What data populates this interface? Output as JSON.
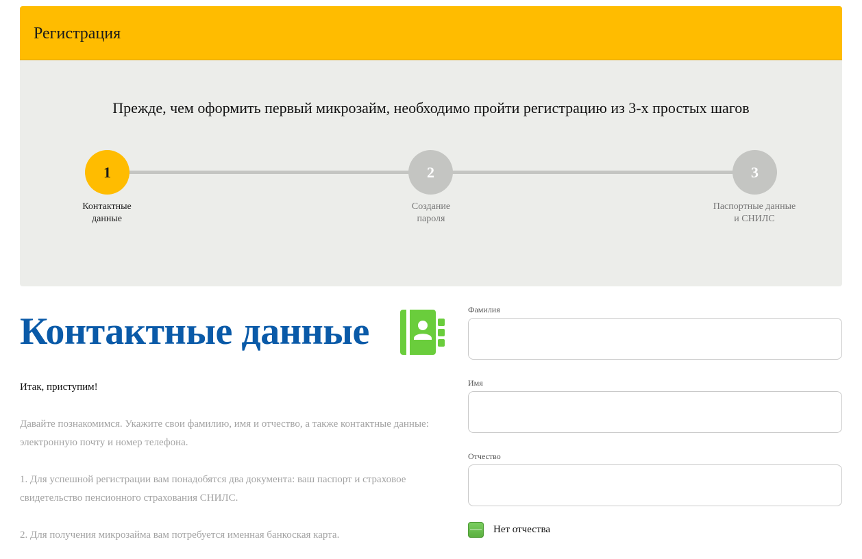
{
  "header": {
    "title": "Регистрация",
    "accent_color": "#ffbc00"
  },
  "intro_text": "Прежде, чем оформить первый микрозайм, необходимо пройти регистрацию из 3-х простых шагов",
  "steps": [
    {
      "number": "1",
      "line1": "Контактные",
      "line2": "данные",
      "active": true
    },
    {
      "number": "2",
      "line1": "Создание",
      "line2": "пароля",
      "active": false
    },
    {
      "number": "3",
      "line1": "Паспортные данные",
      "line2": "и СНИЛС",
      "active": false
    }
  ],
  "section": {
    "title": "Контактные данные",
    "title_color": "#0a5aa8",
    "icon": "contact-book-icon",
    "icon_color": "#6acd3c",
    "lead": "Итак, приступим!",
    "paragraphs": [
      "Давайте познакомимся. Укажите свои фамилию, имя и отчество, а также контактные данные: электронную почту и номер телефона.",
      "1. Для успешной регистрации вам понадобятся два документа: ваш паспорт и страховое свидетельство пенсионного страхования СНИЛС.",
      "2. Для получения микрозайма вам потребуется именная банкоская карта."
    ]
  },
  "form": {
    "surname": {
      "label": "Фамилия",
      "value": ""
    },
    "name": {
      "label": "Имя",
      "value": ""
    },
    "patronymic": {
      "label": "Отчество",
      "value": ""
    },
    "no_patronymic_label": "Нет отчества"
  }
}
